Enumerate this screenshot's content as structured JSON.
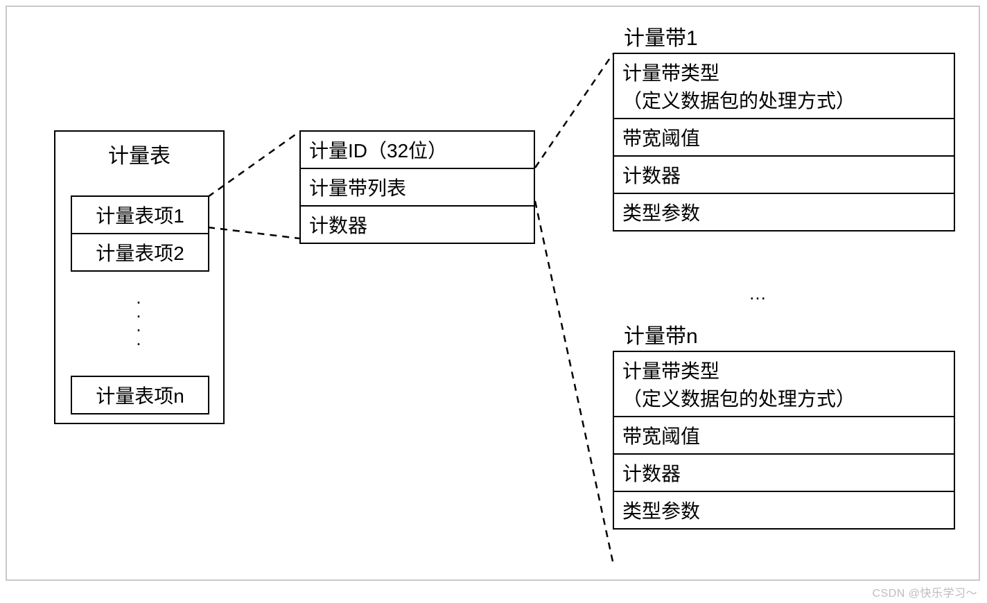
{
  "watermark": "CSDN @快乐学习～",
  "meter_table": {
    "title": "计量表",
    "items": [
      "计量表项1",
      "计量表项2",
      "计量表项n"
    ],
    "ellipsis": ". . . ."
  },
  "meter_entry": {
    "rows": [
      "计量ID（32位）",
      "计量带列表",
      "计数器"
    ]
  },
  "band_section": {
    "band1_title": "计量带1",
    "bandn_title": "计量带n",
    "rows": [
      "计量带类型\n（定义数据包的处理方式）",
      "带宽阈值",
      "计数器",
      "类型参数"
    ],
    "ellipsis": "…"
  }
}
